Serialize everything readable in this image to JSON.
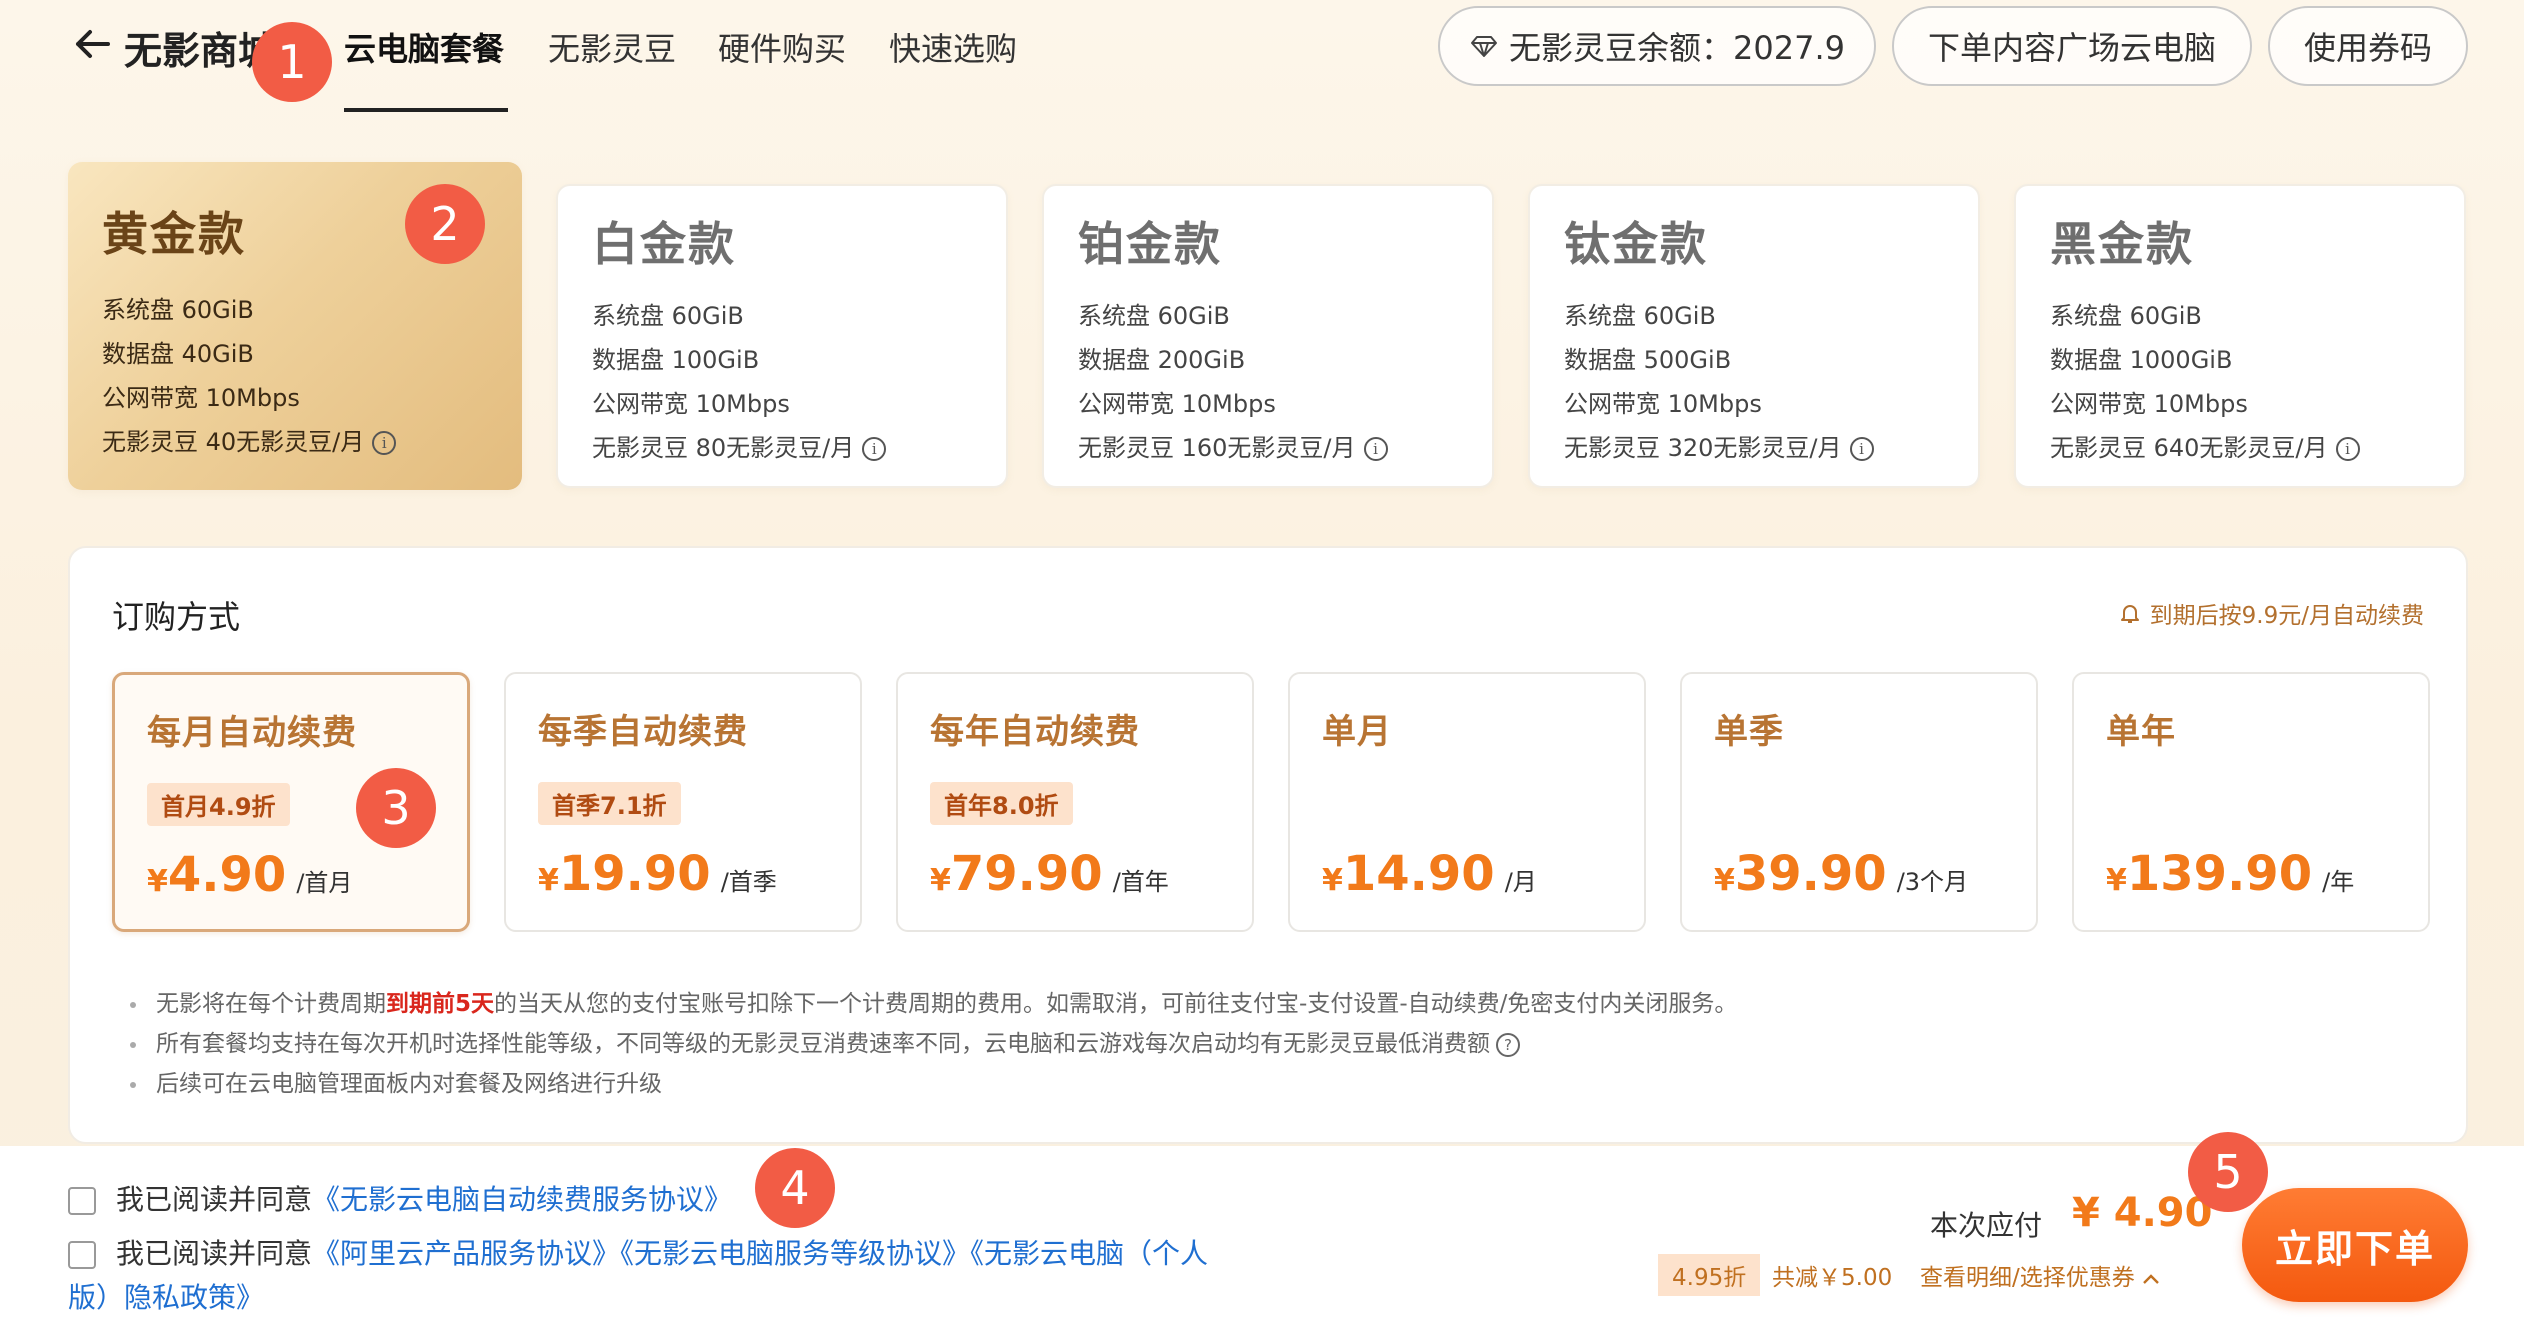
{
  "header": {
    "brand": "无影商城",
    "tabs": [
      "云电脑套餐",
      "无影灵豆",
      "硬件购买",
      "快速选购"
    ],
    "balance_label": "无影灵豆余额：2027.9",
    "plaza_button": "下单内容广场云电脑",
    "coupon_button": "使用券码"
  },
  "badges": [
    "1",
    "2",
    "3",
    "4",
    "5"
  ],
  "plans": [
    {
      "name": "黄金款",
      "system_disk": "系统盘 60GiB",
      "data_disk": "数据盘 40GiB",
      "bandwidth": "公网带宽 10Mbps",
      "beans": "无影灵豆 40无影灵豆/月"
    },
    {
      "name": "白金款",
      "system_disk": "系统盘 60GiB",
      "data_disk": "数据盘 100GiB",
      "bandwidth": "公网带宽 10Mbps",
      "beans": "无影灵豆 80无影灵豆/月"
    },
    {
      "name": "铂金款",
      "system_disk": "系统盘 60GiB",
      "data_disk": "数据盘 200GiB",
      "bandwidth": "公网带宽 10Mbps",
      "beans": "无影灵豆 160无影灵豆/月"
    },
    {
      "name": "钛金款",
      "system_disk": "系统盘 60GiB",
      "data_disk": "数据盘 500GiB",
      "bandwidth": "公网带宽 10Mbps",
      "beans": "无影灵豆 320无影灵豆/月"
    },
    {
      "name": "黑金款",
      "system_disk": "系统盘 60GiB",
      "data_disk": "数据盘 1000GiB",
      "bandwidth": "公网带宽 10Mbps",
      "beans": "无影灵豆 640无影灵豆/月"
    }
  ],
  "subscription": {
    "title": "订购方式",
    "renew_note": "到期后按9.9元/月自动续费",
    "options": [
      {
        "name": "每月自动续费",
        "tag": "首月4.9折",
        "currency": "¥",
        "price": "4.90",
        "unit": "/首月"
      },
      {
        "name": "每季自动续费",
        "tag": "首季7.1折",
        "currency": "¥",
        "price": "19.90",
        "unit": "/首季"
      },
      {
        "name": "每年自动续费",
        "tag": "首年8.0折",
        "currency": "¥",
        "price": "79.90",
        "unit": "/首年"
      },
      {
        "name": "单月",
        "tag": "",
        "currency": "¥",
        "price": "14.90",
        "unit": "/月"
      },
      {
        "name": "单季",
        "tag": "",
        "currency": "¥",
        "price": "39.90",
        "unit": "/3个月"
      },
      {
        "name": "单年",
        "tag": "",
        "currency": "¥",
        "price": "139.90",
        "unit": "/年"
      }
    ],
    "notes": {
      "n1_a": "无影将在每个计费周期",
      "n1_red": "到期前5天",
      "n1_b": "的当天从您的支付宝账号扣除下一个计费周期的费用。如需取消，可前往支付宝-支付设置-自动续费/免密支付内关闭服务。",
      "n2": "所有套餐均支持在每次开机时选择性能等级，不同等级的无影灵豆消费速率不同，云电脑和云游戏每次启动均有无影灵豆最低消费额",
      "n3": "后续可在云电脑管理面板内对套餐及网络进行升级"
    }
  },
  "footer": {
    "agree_prefix": "我已阅读并同意",
    "agreement1": "《无影云电脑自动续费服务协议》",
    "agreement2": "《阿里云产品服务协议》《无影云电脑服务等级协议》《无影云电脑（个人",
    "agreement2_cont": "版）隐私政策》",
    "pay_label": "本次应付",
    "pay_amount": "¥ 4.90",
    "discount_tag": "4.95折",
    "save_note": "共减￥5.00",
    "detail_link": "查看明细/选择优惠券",
    "order_button": "立即下单"
  }
}
